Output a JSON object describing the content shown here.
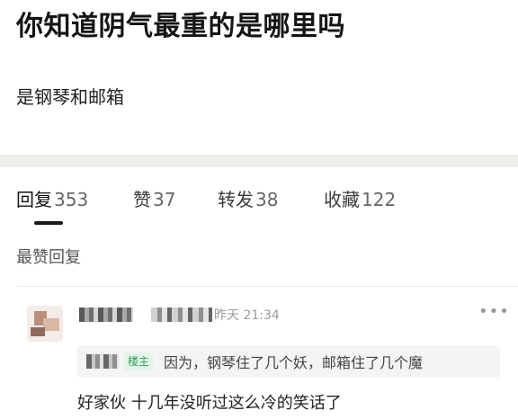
{
  "post": {
    "title": "你知道阴气最重的是哪里吗",
    "body": "是钢琴和邮箱"
  },
  "tabs": [
    {
      "label": "回复",
      "count": "353",
      "active": true
    },
    {
      "label": "赞",
      "count": "37",
      "active": false
    },
    {
      "label": "转发",
      "count": "38",
      "active": false
    },
    {
      "label": "收藏",
      "count": "122",
      "active": false
    }
  ],
  "section_heading": "最赞回复",
  "comment": {
    "time": "昨天 21:34",
    "more_icon": "more-dots-icon",
    "quote": {
      "badge": "楼主",
      "text": "因为，钢琴住了几个妖，邮箱住了几个魔"
    },
    "text": "好家伙 十几年没听过这么冷的笑话了"
  }
}
